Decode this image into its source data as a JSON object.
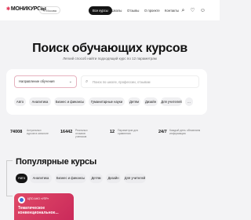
{
  "header": {
    "logo": "МОНИКУРСЫ",
    "location": "Москва",
    "nav": [
      "Все курсы",
      "Школы",
      "Отзывы",
      "О проекте",
      "Контакты"
    ]
  },
  "hero": {
    "title": "Поиск обучающих курсов",
    "subtitle": "Легкий способ найти подходящий курс по 12 параметрам"
  },
  "search": {
    "direction_label": "Направление обучения",
    "placeholder": "Поиск по школе, профессии, отзывам"
  },
  "chips": [
    "Авто",
    "Аналитика",
    "Бизнес и финансы",
    "Гуманитарные науки",
    "Детям",
    "Дизайн",
    "Для учителей",
    "..."
  ],
  "stats": [
    {
      "value": "74008",
      "label": "Актуальных курсов в каталоге"
    },
    {
      "value": "16442",
      "label": "Реальных отзывов учеников"
    },
    {
      "value": "12",
      "label": "Параметров для сравнения"
    },
    {
      "value": "24/7",
      "label": "Каждый день обновляем информацию"
    }
  ],
  "popular": {
    "title": "Популярные курсы",
    "tabs": [
      "Авто",
      "Аналитика",
      "Бизнес и финансы",
      "Детям",
      "Дизайн",
      "Для учителей"
    ],
    "active_tab": 0
  },
  "card": {
    "school": "ЦПО АНО «УПР»",
    "title": "Тематическое конвенциональное..."
  },
  "colors": {
    "accent": "#e23b5b",
    "active_bg": "#151515",
    "page_bg": "#f3f3f5"
  }
}
